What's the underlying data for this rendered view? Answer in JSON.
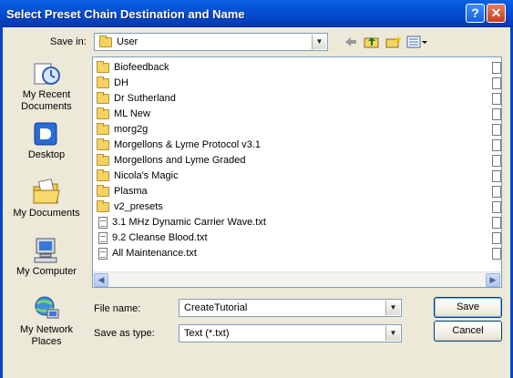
{
  "window": {
    "title": "Select Preset Chain Destination and Name",
    "help_label": "?",
    "close_label": "✕"
  },
  "savein": {
    "label": "Save in:",
    "value": "User"
  },
  "toolbar": {
    "back_icon": "back-arrow-icon",
    "up_icon": "up-folder-icon",
    "new_folder_icon": "new-folder-icon",
    "view_menu_icon": "view-menu-icon"
  },
  "places": [
    {
      "label": "My Recent Documents",
      "icon": "recent-documents-icon"
    },
    {
      "label": "Desktop",
      "icon": "desktop-icon"
    },
    {
      "label": "My Documents",
      "icon": "my-documents-icon"
    },
    {
      "label": "My Computer",
      "icon": "my-computer-icon"
    },
    {
      "label": "My Network Places",
      "icon": "network-places-icon"
    }
  ],
  "files": [
    {
      "name": "Biofeedback",
      "type": "folder"
    },
    {
      "name": "DH",
      "type": "folder"
    },
    {
      "name": "Dr Sutherland",
      "type": "folder"
    },
    {
      "name": "ML New",
      "type": "folder"
    },
    {
      "name": "morg2g",
      "type": "folder"
    },
    {
      "name": "Morgellons & Lyme Protocol v3.1",
      "type": "folder"
    },
    {
      "name": "Morgellons and Lyme Graded",
      "type": "folder"
    },
    {
      "name": "Nicola's Magic",
      "type": "folder"
    },
    {
      "name": "Plasma",
      "type": "folder"
    },
    {
      "name": "v2_presets",
      "type": "folder"
    },
    {
      "name": "3.1 MHz Dynamic Carrier Wave.txt",
      "type": "txt"
    },
    {
      "name": "9.2 Cleanse Blood.txt",
      "type": "txt"
    },
    {
      "name": "All Maintenance.txt",
      "type": "txt"
    }
  ],
  "filename": {
    "label": "File name:",
    "value": "CreateTutorial"
  },
  "filetype": {
    "label": "Save as type:",
    "value": "Text (*.txt)"
  },
  "buttons": {
    "save": "Save",
    "cancel": "Cancel"
  },
  "colors": {
    "titlebar": "#0546c6",
    "dialog_bg": "#ece9d8",
    "folder": "#f5d362"
  }
}
